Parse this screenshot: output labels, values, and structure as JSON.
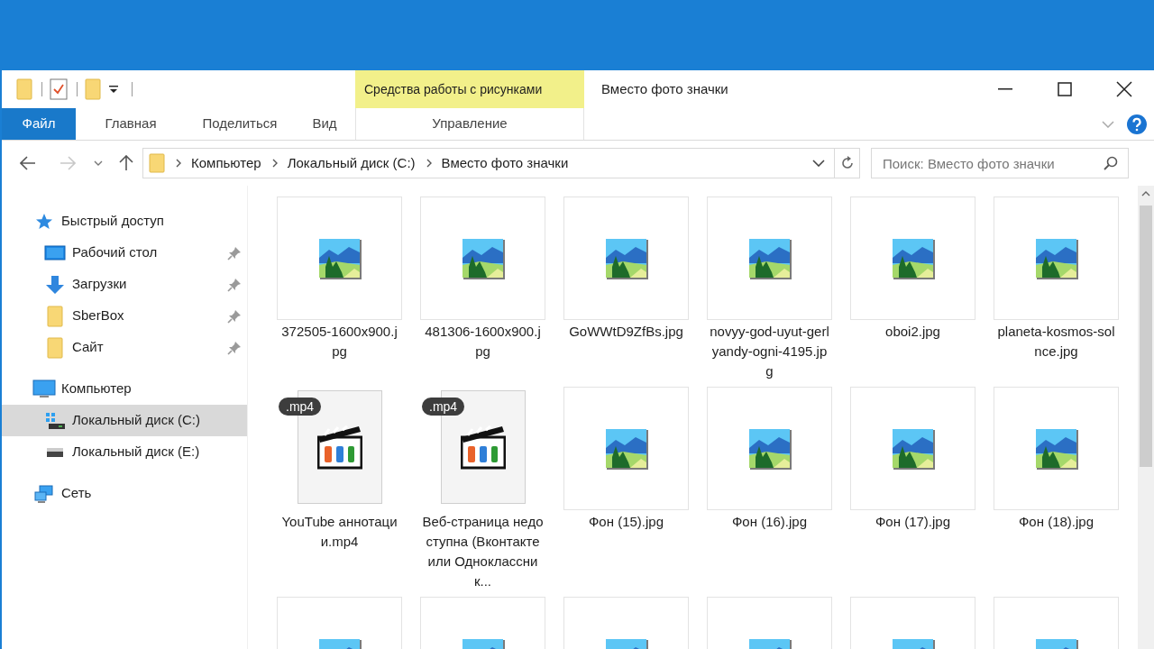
{
  "quick_access_toolbar": {
    "items": [
      {
        "kind": "folder"
      },
      {
        "kind": "properties"
      },
      {
        "kind": "new-folder"
      },
      {
        "kind": "dropdown"
      }
    ]
  },
  "context_tab_group": {
    "title": "Средства работы с рисунками",
    "tab": "Управление"
  },
  "window": {
    "title": "Вместо фото значки"
  },
  "ribbon_tabs": [
    {
      "label": "Файл",
      "selected": true
    },
    {
      "label": "Главная",
      "selected": false
    },
    {
      "label": "Поделиться",
      "selected": false
    },
    {
      "label": "Вид",
      "selected": false
    }
  ],
  "address_bar": {
    "segments": [
      "Компьютер",
      "Локальный диск (C:)",
      "Вместо фото значки"
    ]
  },
  "search": {
    "placeholder": "Поиск: Вместо фото значки"
  },
  "sidebar": {
    "items": [
      {
        "label": "Быстрый доступ",
        "kind": "star",
        "selected": false,
        "children": [
          {
            "label": "Рабочий стол",
            "kind": "desktop",
            "pinned": true,
            "selected": false
          },
          {
            "label": "Загрузки",
            "kind": "download",
            "pinned": true,
            "selected": false
          },
          {
            "label": "SberBox",
            "kind": "folder",
            "pinned": true,
            "selected": false
          },
          {
            "label": "Сайт",
            "kind": "folder",
            "pinned": true,
            "selected": false
          }
        ]
      },
      {
        "label": "Компьютер",
        "kind": "computer",
        "selected": false,
        "children": [
          {
            "label": "Локальный диск (C:)",
            "kind": "system-drive",
            "pinned": false,
            "selected": true
          },
          {
            "label": "Локальный диск (E:)",
            "kind": "drive",
            "pinned": false,
            "selected": false
          }
        ]
      },
      {
        "label": "Сеть",
        "kind": "network",
        "selected": false
      }
    ]
  },
  "files": [
    {
      "kind": "image",
      "name": "372505-1600x900.jpg"
    },
    {
      "kind": "image",
      "name": "481306-1600x900.jpg"
    },
    {
      "kind": "image",
      "name": "GoWWtD9ZfBs.jpg"
    },
    {
      "kind": "image",
      "name": "novyy-god-uyut-gerlyandy-ogni-4195.jpg"
    },
    {
      "kind": "image",
      "name": "oboi2.jpg"
    },
    {
      "kind": "image",
      "name": "planeta-kosmos-solnce.jpg"
    },
    {
      "kind": "video",
      "badge": ".mp4",
      "name": "YouTube аннотации.mp4"
    },
    {
      "kind": "video",
      "badge": ".mp4",
      "name": "Веб-страница недоступна (Вконтакте или Одноклассник..."
    },
    {
      "kind": "image",
      "name": "Фон (15).jpg"
    },
    {
      "kind": "image",
      "name": "Фон (16).jpg"
    },
    {
      "kind": "image",
      "name": "Фон (17).jpg"
    },
    {
      "kind": "image",
      "name": "Фон (18).jpg"
    },
    {
      "kind": "image"
    },
    {
      "kind": "image"
    },
    {
      "kind": "image"
    },
    {
      "kind": "image"
    },
    {
      "kind": "image"
    },
    {
      "kind": "image"
    }
  ]
}
